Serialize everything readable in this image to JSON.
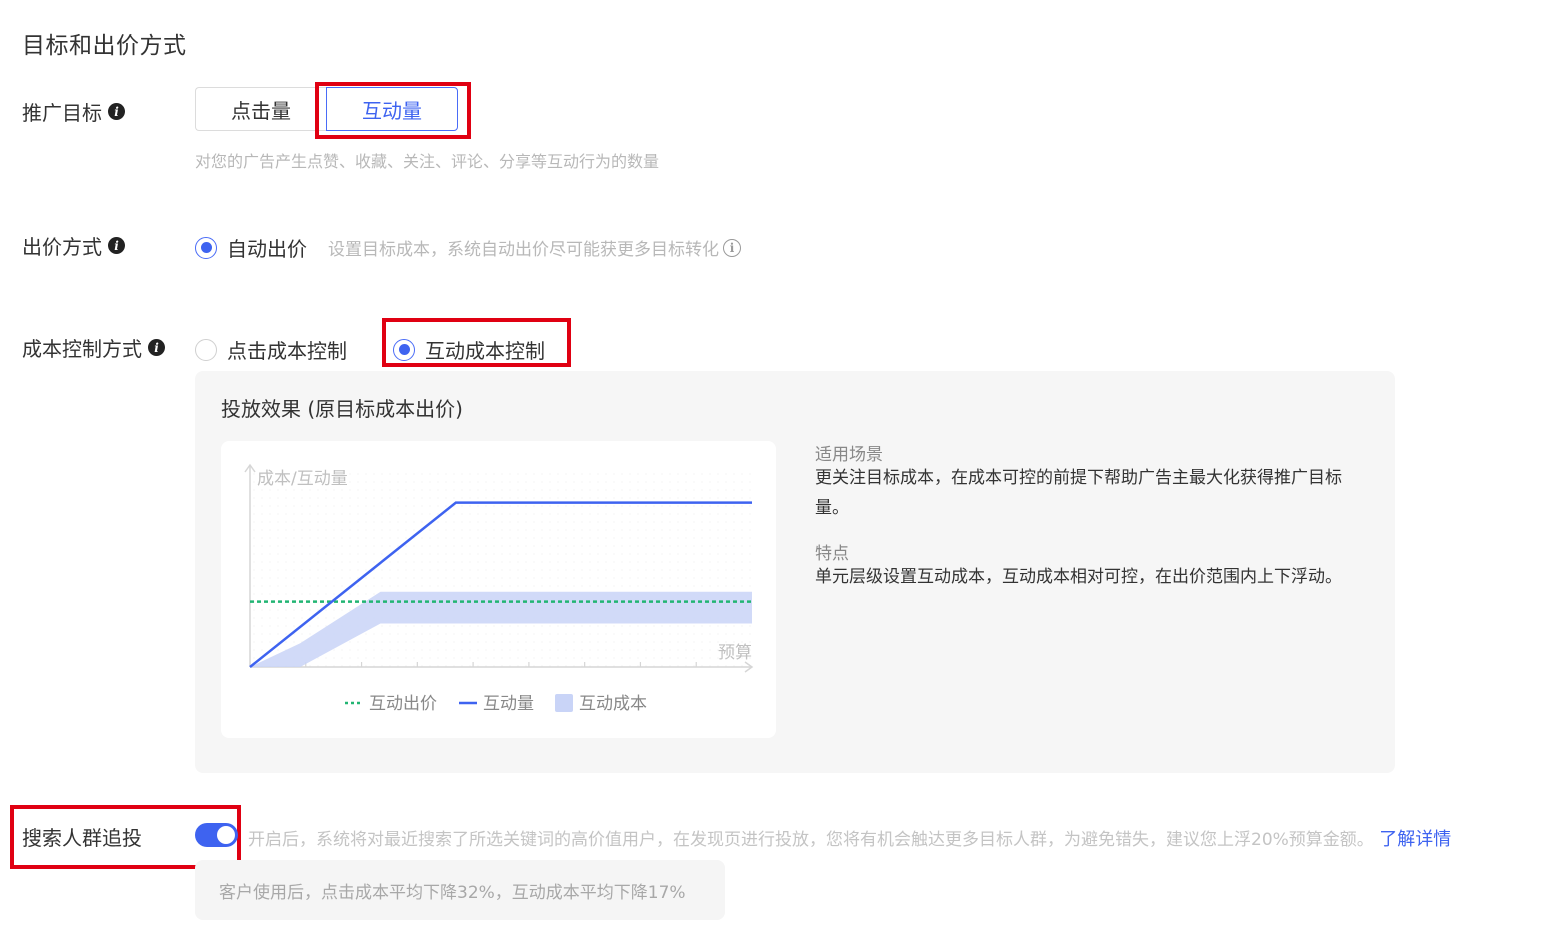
{
  "section_title": "目标和出价方式",
  "promotion_goal": {
    "label": "推广目标",
    "options": [
      "点击量",
      "互动量"
    ],
    "selected": "互动量",
    "hint": "对您的广告产生点赞、收藏、关注、评论、分享等互动行为的数量"
  },
  "bid_method": {
    "label": "出价方式",
    "option": "自动出价",
    "hint": "设置目标成本，系统自动出价尽可能获更多目标转化"
  },
  "cost_control": {
    "label": "成本控制方式",
    "options": [
      "点击成本控制",
      "互动成本控制"
    ],
    "selected": "互动成本控制"
  },
  "effect_panel": {
    "title": "投放效果 (原目标成本出价)",
    "scenario_label": "适用场景",
    "scenario_text": "更关注目标成本，在成本可控的前提下帮助广告主最大化获得推广目标量。",
    "feature_label": "特点",
    "feature_text": "单元层级设置互动成本，互动成本相对可控，在出价范围内上下浮动。"
  },
  "chart_data": {
    "type": "line",
    "ylabel": "成本/互动量",
    "xlabel": "预算",
    "series": [
      {
        "name": "互动出价",
        "style": "dashed",
        "color": "#22b573",
        "x": [
          0,
          1
        ],
        "y": [
          0.33,
          0.33
        ]
      },
      {
        "name": "互动量",
        "style": "solid",
        "color": "#3e63f0",
        "x": [
          0,
          0.41,
          1
        ],
        "y": [
          0,
          0.83,
          0.83
        ]
      },
      {
        "name": "互动成本",
        "style": "band",
        "color": "#c9d4f7",
        "x": [
          0,
          0.1,
          0.26,
          1
        ],
        "low": [
          0,
          0,
          0.22,
          0.22
        ],
        "high": [
          0,
          0.12,
          0.38,
          0.38
        ]
      }
    ],
    "xlim": [
      0,
      1
    ],
    "ylim": [
      0,
      1
    ],
    "legend_position": "bottom"
  },
  "search_retarget": {
    "label": "搜索人群追投",
    "enabled": true,
    "hint": "开启后，系统将对最近搜索了所选关键词的高价值用户，在发现页进行投放，您将有机会触达更多目标人群，为避免错失，建议您上浮20%预算金额。",
    "link": "了解详情",
    "stats": "客户使用后，点击成本平均下降32%，互动成本平均下降17%"
  },
  "colors": {
    "accent": "#3e63f0",
    "highlight": "#e00012",
    "bid_line": "#22b573"
  },
  "icons": [
    "info-icon",
    "info-outline-icon"
  ]
}
